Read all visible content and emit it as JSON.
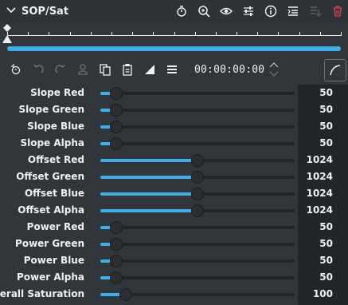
{
  "header": {
    "title": "SOP/Sat",
    "icons": [
      "timer-icon",
      "search-icon",
      "eye-icon",
      "sliders-icon",
      "info-icon",
      "list-icon",
      "save-icon",
      "trash-icon"
    ]
  },
  "toolbar": {
    "timecode": "00:00:00:00",
    "icons": [
      "keyframe-add-icon",
      "undo-icon",
      "redo-icon",
      "user-icon",
      "copy-icon",
      "paste-icon",
      "ramp-icon",
      "menu-icon",
      "curve-icon"
    ]
  },
  "params": [
    {
      "label": "Slope Red",
      "value": "50",
      "fraction": 0.083
    },
    {
      "label": "Slope Green",
      "value": "50",
      "fraction": 0.083
    },
    {
      "label": "Slope Blue",
      "value": "50",
      "fraction": 0.083
    },
    {
      "label": "Slope Alpha",
      "value": "50",
      "fraction": 0.083
    },
    {
      "label": "Offset Red",
      "value": "1024",
      "fraction": 0.5
    },
    {
      "label": "Offset Green",
      "value": "1024",
      "fraction": 0.5
    },
    {
      "label": "Offset Blue",
      "value": "1024",
      "fraction": 0.5
    },
    {
      "label": "Offset Alpha",
      "value": "1024",
      "fraction": 0.5
    },
    {
      "label": "Power Red",
      "value": "50",
      "fraction": 0.083
    },
    {
      "label": "Power Green",
      "value": "50",
      "fraction": 0.083
    },
    {
      "label": "Power Blue",
      "value": "50",
      "fraction": 0.083
    },
    {
      "label": "Power Alpha",
      "value": "50",
      "fraction": 0.083
    },
    {
      "label": "Overall Saturation",
      "value": "100",
      "fraction": 0.13
    }
  ],
  "colors": {
    "accent": "#3daee9",
    "background": "#31363b",
    "value_bg": "#232629",
    "delete": "#da4453"
  }
}
